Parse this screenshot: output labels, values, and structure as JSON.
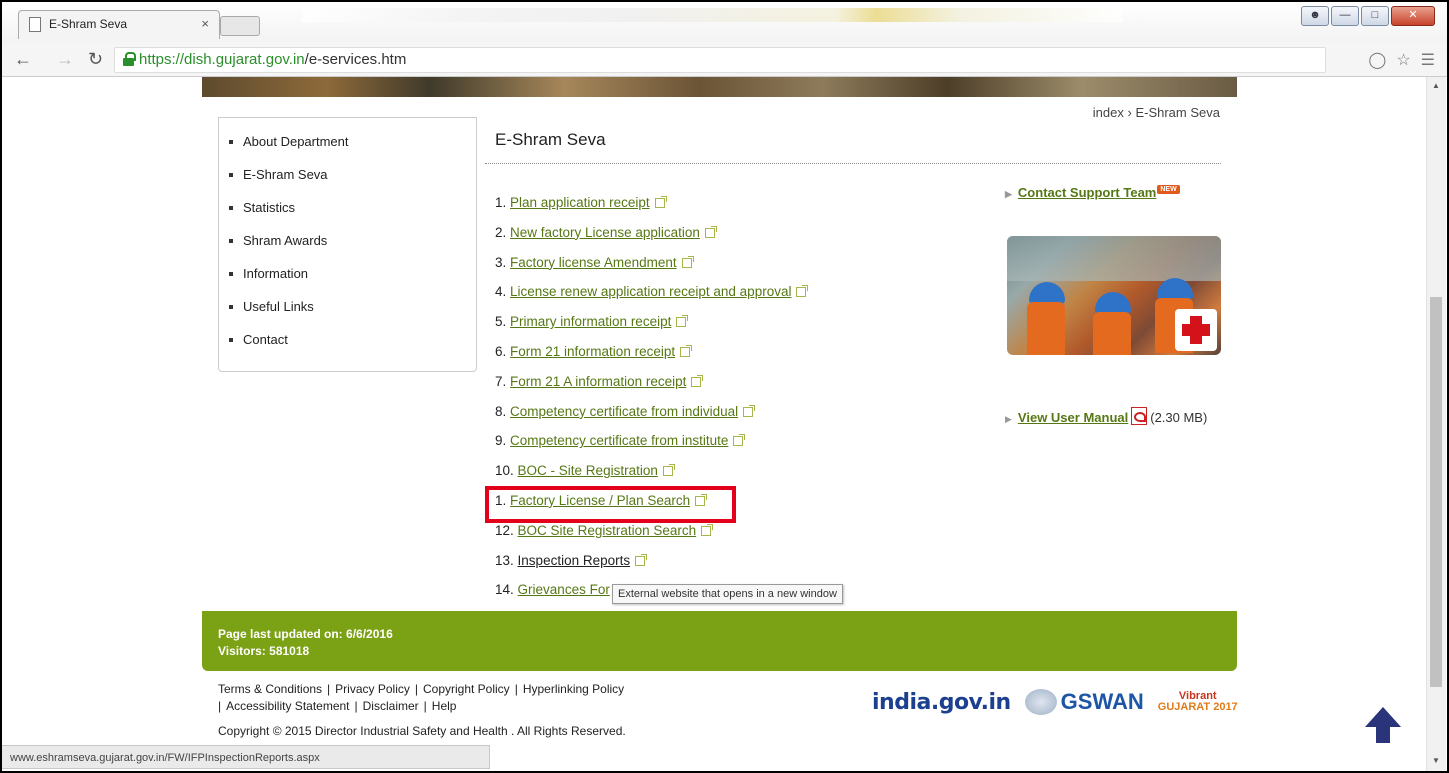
{
  "browser": {
    "tab_title": "E-Shram Seva",
    "tab_close": "×",
    "url_secure": "https://dish.gujarat.gov.in",
    "url_path": "/e-services.htm"
  },
  "breadcrumb": {
    "home": "index",
    "separator": "›",
    "current": "E-Shram Seva"
  },
  "sidebar": {
    "items": [
      {
        "label": "About Department"
      },
      {
        "label": "E-Shram Seva"
      },
      {
        "label": "Statistics"
      },
      {
        "label": "Shram Awards"
      },
      {
        "label": "Information"
      },
      {
        "label": "Useful Links"
      },
      {
        "label": "Contact"
      }
    ]
  },
  "main": {
    "title": "E-Shram Seva",
    "services": [
      {
        "num": "1.",
        "label": "Plan application receipt"
      },
      {
        "num": "2.",
        "label": "New factory License application"
      },
      {
        "num": "3.",
        "label": "Factory license Amendment"
      },
      {
        "num": "4.",
        "label": "License renew application receipt and approval"
      },
      {
        "num": "5.",
        "label": "Primary information receipt"
      },
      {
        "num": "6.",
        "label": "Form 21 information receipt"
      },
      {
        "num": "7.",
        "label": "Form 21 A information receipt"
      },
      {
        "num": "8.",
        "label": "Competency certificate from individual"
      },
      {
        "num": "9.",
        "label": "Competency certificate from institute"
      },
      {
        "num": "10.",
        "label": "BOC - Site Registration"
      },
      {
        "num": "1.",
        "label": "Factory License / Plan Search"
      },
      {
        "num": "12.",
        "label": "BOC Site Registration Search"
      },
      {
        "num": "13.",
        "label": "Inspection Reports"
      },
      {
        "num": "14.",
        "label": "Grievances For"
      }
    ],
    "tooltip": "External website that opens in a new window"
  },
  "right": {
    "support_link": "Contact Support Team",
    "new_badge": "NEW",
    "manual_link": "View User Manual",
    "manual_size": "(2.30 MB)"
  },
  "footer": {
    "updated_label": "Page last updated on:",
    "updated_value": "6/6/2016",
    "visitors_label": "Visitors:",
    "visitors_value": "581018",
    "links": [
      "Terms & Conditions",
      "Privacy Policy",
      "Copyright Policy",
      "Hyperlinking Policy",
      "Accessibility Statement",
      "Disclaimer",
      "Help"
    ],
    "copyright": "Copyright © 2015 Director Industrial Safety and Health . All Rights Reserved.",
    "logo_india": "india.gov.in",
    "logo_gswan": "GSWAN",
    "logo_vg_top": "Vibrant",
    "logo_vg_bottom": "GUJARAT 2017"
  },
  "status_url": "www.eshramseva.gujarat.gov.in/FW/IFPInspectionReports.aspx"
}
